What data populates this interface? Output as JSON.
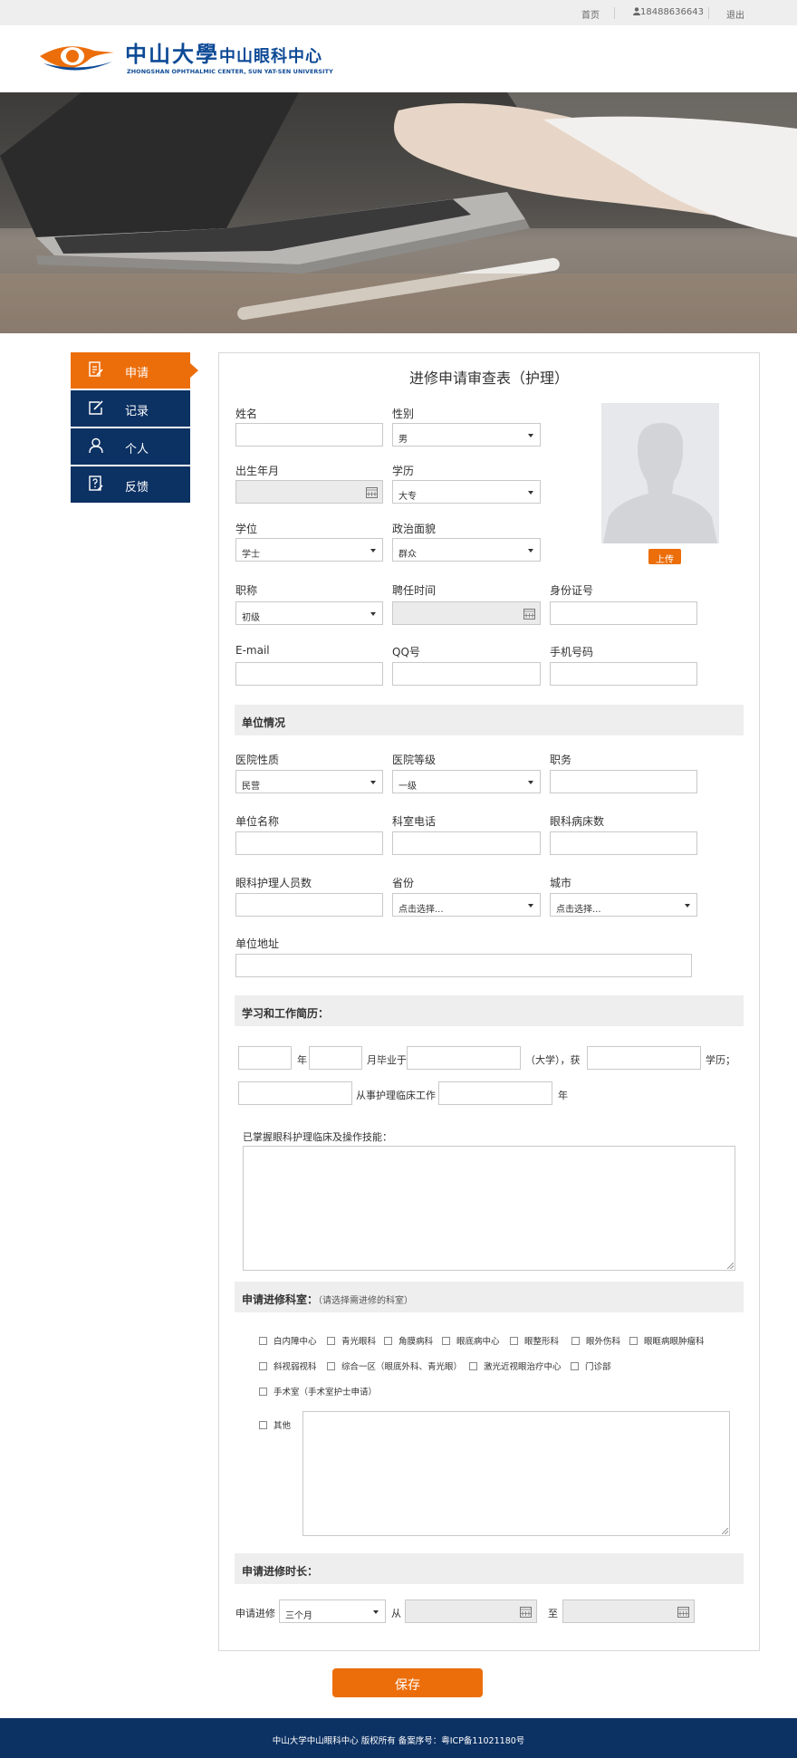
{
  "topbar": {
    "home": "首页",
    "phone": "18488636643",
    "logout": "退出"
  },
  "logo": {
    "cn_big": "中山大學",
    "cn_mid": "中山眼科中心",
    "en": "ZHONGSHAN OPHTHALMIC CENTER, SUN YAT-SEN UNIVERSITY"
  },
  "colors": {
    "accent": "#ec6e0b",
    "nav": "#0c3163",
    "section_bg": "#eeeeee",
    "logo_blue": "#0d4a96"
  },
  "sidebar": {
    "items": [
      {
        "label": "申请",
        "icon": "edit-doc-icon",
        "active": true
      },
      {
        "label": "记录",
        "icon": "pencil-square-icon",
        "active": false
      },
      {
        "label": "个人",
        "icon": "user-icon",
        "active": false
      },
      {
        "label": "反馈",
        "icon": "help-doc-icon",
        "active": false
      }
    ]
  },
  "form": {
    "title": "进修申请审查表（护理）",
    "photo_upload": "上传",
    "labels": {
      "name": "姓名",
      "gender": "性别",
      "birth": "出生年月",
      "education": "学历",
      "degree": "学位",
      "politics": "政治面貌",
      "title": "职称",
      "hire_date": "聘任时间",
      "id_no": "身份证号",
      "email": "E-mail",
      "qq": "QQ号",
      "mobile": "手机号码"
    },
    "values": {
      "gender": "男",
      "education": "大专",
      "degree": "学士",
      "politics": "群众",
      "title": "初级"
    },
    "unit": {
      "heading": "单位情况",
      "labels": {
        "hospital_type": "医院性质",
        "hospital_level": "医院等级",
        "position": "职务",
        "unit_name": "单位名称",
        "dept_phone": "科室电话",
        "eye_beds": "眼科病床数",
        "nurse_count": "眼科护理人员数",
        "province": "省份",
        "city": "城市",
        "address": "单位地址"
      },
      "values": {
        "hospital_type": "民营",
        "hospital_level": "一级",
        "province": "点击选择...",
        "city": "点击选择..."
      }
    },
    "resume": {
      "heading": "学习和工作简历：",
      "year": "年",
      "month_grad": "月毕业于",
      "univ": "（大学），获",
      "degree_suffix": "学历；",
      "work_from": "从事护理临床工作",
      "year2": "年",
      "skills_label": "已掌握眼科护理临床及操作技能："
    },
    "dept": {
      "heading": "申请进修科室：",
      "heading_sub": "（请选择需进修的科室）",
      "options": [
        "白内障中心",
        "青光眼科",
        "角膜病科",
        "眼底病中心",
        "眼整形科",
        "眼外伤科",
        "眼眶病眼肿瘤科",
        "斜视弱视科",
        "综合一区（眼底外科、青光眼）",
        "激光近视眼治疗中心",
        "门诊部",
        "手术室（手术室护士申请）",
        "其他"
      ]
    },
    "duration": {
      "heading": "申请进修时长：",
      "label": "申请进修",
      "value": "三个月",
      "from": "从",
      "to": "至"
    },
    "save": "保存"
  },
  "footer": {
    "text": "中山大学中山眼科中心 版权所有 备案序号：粤ICP备11021180号"
  }
}
